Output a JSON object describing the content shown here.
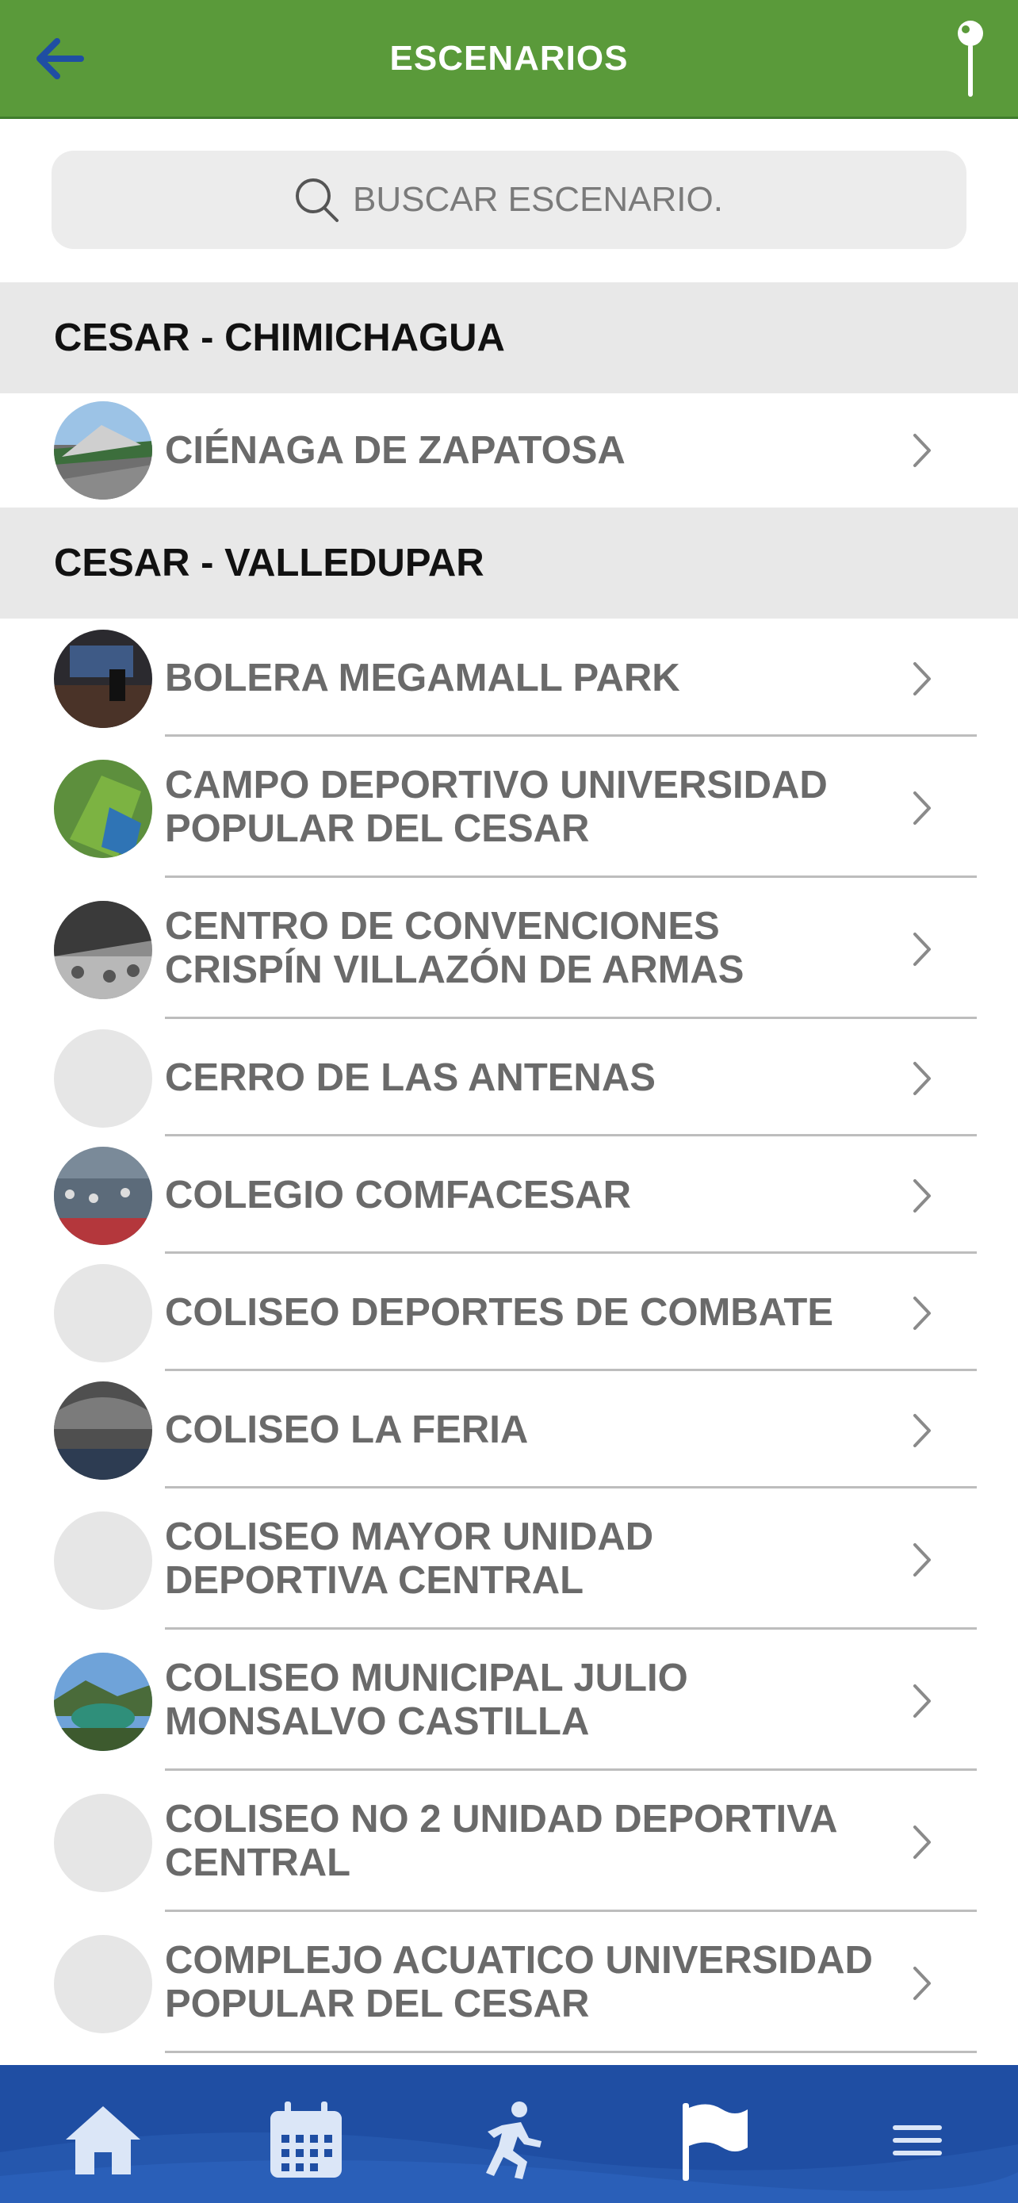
{
  "header": {
    "title": "ESCENARIOS",
    "back_icon": "arrow-left-icon",
    "map_icon": "map-pin-icon",
    "accent": "#5a9a3a"
  },
  "search": {
    "placeholder": "BUSCAR ESCENARIO...",
    "icon": "search-icon"
  },
  "sections": [
    {
      "title": "CESAR - CHIMICHAGUA",
      "items": [
        {
          "label": "CIÉNAGA DE ZAPATOSA",
          "thumb": "photo"
        }
      ]
    },
    {
      "title": "CESAR - VALLEDUPAR",
      "items": [
        {
          "label": "BOLERA MEGAMALL PARK",
          "thumb": "photo"
        },
        {
          "label": "CAMPO DEPORTIVO UNIVERSIDAD POPULAR DEL CESAR",
          "thumb": "photo"
        },
        {
          "label": "CENTRO DE CONVENCIONES CRISPÍN VILLAZÓN DE ARMAS",
          "thumb": "photo"
        },
        {
          "label": "CERRO DE LAS ANTENAS",
          "thumb": "placeholder"
        },
        {
          "label": "COLEGIO COMFACESAR",
          "thumb": "photo"
        },
        {
          "label": "COLISEO DEPORTES DE COMBATE",
          "thumb": "placeholder"
        },
        {
          "label": "COLISEO LA FERIA",
          "thumb": "photo"
        },
        {
          "label": "COLISEO MAYOR UNIDAD DEPORTIVA CENTRAL",
          "thumb": "placeholder"
        },
        {
          "label": "COLISEO MUNICIPAL JULIO MONSALVO CASTILLA",
          "thumb": "photo"
        },
        {
          "label": "COLISEO NO 2 UNIDAD DEPORTIVA CENTRAL",
          "thumb": "placeholder"
        },
        {
          "label": "COMPLEJO ACUATICO UNIVERSIDAD POPULAR DEL CESAR",
          "thumb": "placeholder"
        }
      ]
    }
  ],
  "bottom_nav": {
    "background": "#1f4ea3",
    "items": [
      {
        "icon": "home-icon"
      },
      {
        "icon": "calendar-icon"
      },
      {
        "icon": "runner-icon"
      },
      {
        "icon": "flag-icon",
        "active": true
      },
      {
        "icon": "menu-icon"
      }
    ]
  }
}
